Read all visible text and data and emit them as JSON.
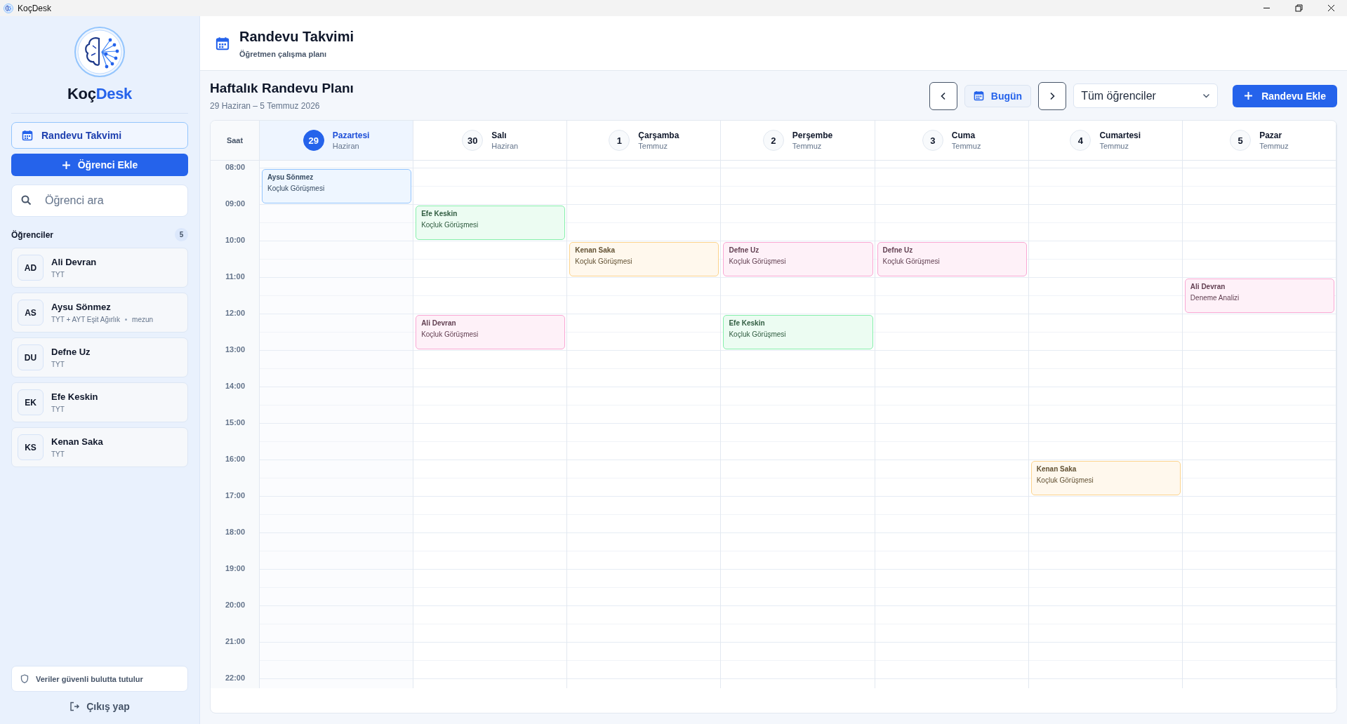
{
  "window": {
    "title": "KoçDesk"
  },
  "sidebar": {
    "brand": {
      "first": "Koç",
      "second": "Desk"
    },
    "nav": {
      "label": "Randevu Takvimi",
      "selected": true
    },
    "add_student_button": "Öğrenci Ekle",
    "search": {
      "placeholder": "Öğrenci ara"
    },
    "students_heading": "Öğrenciler",
    "students_count": "5",
    "students": [
      {
        "initials": "AD",
        "name": "Ali Devran",
        "details": [
          "TYT"
        ]
      },
      {
        "initials": "AS",
        "name": "Aysu Sönmez",
        "details": [
          "TYT + AYT Eşit Ağırlık",
          "mezun"
        ]
      },
      {
        "initials": "DU",
        "name": "Defne Uz",
        "details": [
          "TYT"
        ]
      },
      {
        "initials": "EK",
        "name": "Efe Keskin",
        "details": [
          "TYT"
        ]
      },
      {
        "initials": "KS",
        "name": "Kenan Saka",
        "details": [
          "TYT"
        ]
      }
    ],
    "security_note": "Veriler güvenli bulutta tutulur",
    "logout": "Çıkış yap"
  },
  "header": {
    "title": "Randevu Takvimi",
    "subtitle": "Öğretmen çalışma planı"
  },
  "calendar": {
    "title": "Haftalık Randevu Planı",
    "range": "29 Haziran – 5 Temmuz 2026",
    "today_button": "Bugün",
    "filter": "Tüm öğrenciler",
    "add_button": "Randevu Ekle",
    "time_heading": "Saat",
    "days": [
      {
        "number": "29",
        "name": "Pazartesi",
        "month": "Haziran",
        "selected": true
      },
      {
        "number": "30",
        "name": "Salı",
        "month": "Haziran",
        "selected": false
      },
      {
        "number": "1",
        "name": "Çarşamba",
        "month": "Temmuz",
        "selected": false
      },
      {
        "number": "2",
        "name": "Perşembe",
        "month": "Temmuz",
        "selected": false
      },
      {
        "number": "3",
        "name": "Cuma",
        "month": "Temmuz",
        "selected": false
      },
      {
        "number": "4",
        "name": "Cumartesi",
        "month": "Temmuz",
        "selected": false
      },
      {
        "number": "5",
        "name": "Pazar",
        "month": "Temmuz",
        "selected": false
      }
    ],
    "rows": [
      {
        "time": "08:00",
        "cells": [
          {
            "kind": "appointment",
            "student": "Aysu Sönmez",
            "type": "Koçluk Görüşmesi",
            "color": "#93c5fd"
          },
          {
            "kind": "free"
          },
          {
            "kind": "free"
          },
          {
            "kind": "free"
          },
          {
            "kind": "free"
          },
          {
            "kind": "free"
          },
          {
            "kind": "free"
          }
        ]
      },
      {
        "time": "09:00",
        "cells": [
          {
            "kind": "free"
          },
          {
            "kind": "appointment",
            "student": "Efe Keskin",
            "type": "Koçluk Görüşmesi",
            "color": "#86efac"
          },
          {
            "kind": "free"
          },
          {
            "kind": "free"
          },
          {
            "kind": "free"
          },
          {
            "kind": "free"
          },
          {
            "kind": "free"
          }
        ]
      },
      {
        "time": "10:00",
        "cells": [
          {
            "kind": "free"
          },
          {
            "kind": "free"
          },
          {
            "kind": "appointment",
            "student": "Kenan Saka",
            "type": "Koçluk Görüşmesi",
            "color": "#fcd38d"
          },
          {
            "kind": "appointment",
            "student": "Defne Uz",
            "type": "Koçluk Görüşmesi",
            "color": "#f9a8d4"
          },
          {
            "kind": "appointment",
            "student": "Defne Uz",
            "type": "Koçluk Görüşmesi",
            "color": "#f9a8d4"
          },
          {
            "kind": "free"
          },
          {
            "kind": "free"
          }
        ]
      },
      {
        "time": "11:00",
        "cells": [
          {
            "kind": "free"
          },
          {
            "kind": "free"
          },
          {
            "kind": "free"
          },
          {
            "kind": "free"
          },
          {
            "kind": "free"
          },
          {
            "kind": "free"
          },
          {
            "kind": "appointment",
            "student": "Ali Devran",
            "type": "Deneme Analizi",
            "color": "#f9a8d4"
          }
        ]
      },
      {
        "time": "12:00",
        "cells": [
          {
            "kind": "free"
          },
          {
            "kind": "appointment",
            "student": "Ali Devran",
            "type": "Koçluk Görüşmesi",
            "color": "#f9a8d4"
          },
          {
            "kind": "free"
          },
          {
            "kind": "appointment",
            "student": "Efe Keskin",
            "type": "Koçluk Görüşmesi",
            "color": "#86efac"
          },
          {
            "kind": "free"
          },
          {
            "kind": "free"
          },
          {
            "kind": "free"
          }
        ]
      },
      {
        "time": "13:00",
        "cells": [
          {
            "kind": "free"
          },
          {
            "kind": "free"
          },
          {
            "kind": "free"
          },
          {
            "kind": "free"
          },
          {
            "kind": "free"
          },
          {
            "kind": "free"
          },
          {
            "kind": "free"
          }
        ]
      },
      {
        "time": "14:00",
        "cells": [
          {
            "kind": "free"
          },
          {
            "kind": "free"
          },
          {
            "kind": "free"
          },
          {
            "kind": "free"
          },
          {
            "kind": "free"
          },
          {
            "kind": "free"
          },
          {
            "kind": "free"
          }
        ]
      },
      {
        "time": "15:00",
        "cells": [
          {
            "kind": "free"
          },
          {
            "kind": "free"
          },
          {
            "kind": "free"
          },
          {
            "kind": "free"
          },
          {
            "kind": "free"
          },
          {
            "kind": "free"
          },
          {
            "kind": "free"
          }
        ]
      },
      {
        "time": "16:00",
        "cells": [
          {
            "kind": "free"
          },
          {
            "kind": "free"
          },
          {
            "kind": "free"
          },
          {
            "kind": "free"
          },
          {
            "kind": "free"
          },
          {
            "kind": "appointment",
            "student": "Kenan Saka",
            "type": "Koçluk Görüşmesi",
            "color": "#fcd38d"
          },
          {
            "kind": "free"
          }
        ]
      },
      {
        "time": "17:00",
        "cells": [
          {
            "kind": "free"
          },
          {
            "kind": "free"
          },
          {
            "kind": "free"
          },
          {
            "kind": "free"
          },
          {
            "kind": "free"
          },
          {
            "kind": "free"
          },
          {
            "kind": "free"
          }
        ]
      },
      {
        "time": "18:00",
        "cells": [
          {
            "kind": "free"
          },
          {
            "kind": "free"
          },
          {
            "kind": "free"
          },
          {
            "kind": "free"
          },
          {
            "kind": "free"
          },
          {
            "kind": "free"
          },
          {
            "kind": "free"
          }
        ]
      },
      {
        "time": "19:00",
        "cells": [
          {
            "kind": "free"
          },
          {
            "kind": "free"
          },
          {
            "kind": "free"
          },
          {
            "kind": "free"
          },
          {
            "kind": "free"
          },
          {
            "kind": "free"
          },
          {
            "kind": "free"
          }
        ]
      },
      {
        "time": "20:00",
        "cells": [
          {
            "kind": "free"
          },
          {
            "kind": "free"
          },
          {
            "kind": "free"
          },
          {
            "kind": "free"
          },
          {
            "kind": "free"
          },
          {
            "kind": "free"
          },
          {
            "kind": "free"
          }
        ]
      },
      {
        "time": "21:00",
        "cells": [
          {
            "kind": "free"
          },
          {
            "kind": "free"
          },
          {
            "kind": "free"
          },
          {
            "kind": "free"
          },
          {
            "kind": "free"
          },
          {
            "kind": "free"
          },
          {
            "kind": "free"
          }
        ]
      },
      {
        "time": "22:00",
        "cells": [
          {
            "kind": "free"
          },
          {
            "kind": "free"
          },
          {
            "kind": "free"
          },
          {
            "kind": "free"
          },
          {
            "kind": "free"
          },
          {
            "kind": "free"
          },
          {
            "kind": "free"
          }
        ]
      }
    ]
  }
}
